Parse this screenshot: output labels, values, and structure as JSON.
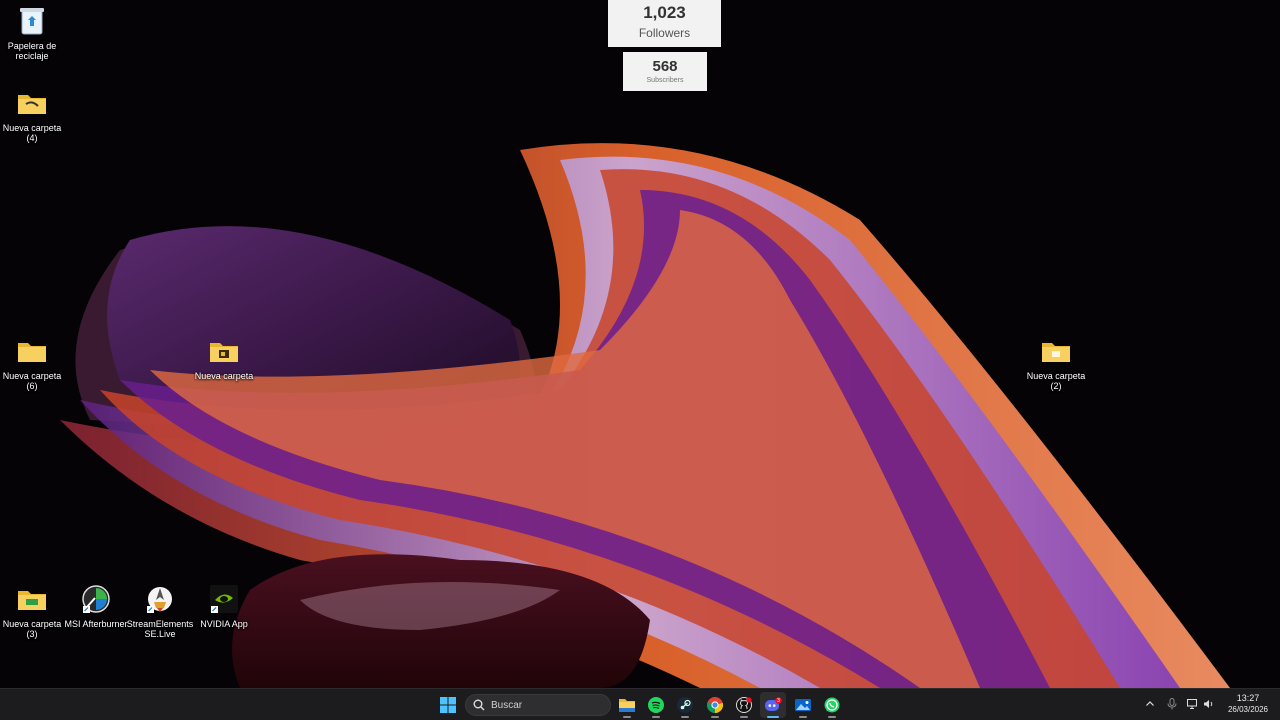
{
  "desktop_icons": {
    "recycle_bin": "Papelera de reciclaje",
    "folder_4": "Nueva carpeta (4)",
    "folder_6": "Nueva carpeta (6)",
    "folder": "Nueva carpeta",
    "folder_2": "Nueva carpeta (2)",
    "folder_3": "Nueva carpeta (3)",
    "msi_afterburner": "MSI Afterburner",
    "streamelements": "StreamElements SE.Live",
    "nvidia_app": "NVIDIA App"
  },
  "widgets": {
    "followers_count": "1,023",
    "followers_label": "Followers",
    "subscribers_count": "568",
    "subscribers_label": "Subscribers"
  },
  "taskbar": {
    "search_placeholder": "Buscar",
    "time": "13:27",
    "date": "26/03/2026",
    "discord_badge": "3",
    "apps": [
      "start-icon",
      "file-explorer-icon",
      "spotify-icon",
      "steam-icon",
      "chrome-icon",
      "github-icon",
      "discord-icon",
      "photos-icon",
      "whatsapp-icon"
    ]
  }
}
